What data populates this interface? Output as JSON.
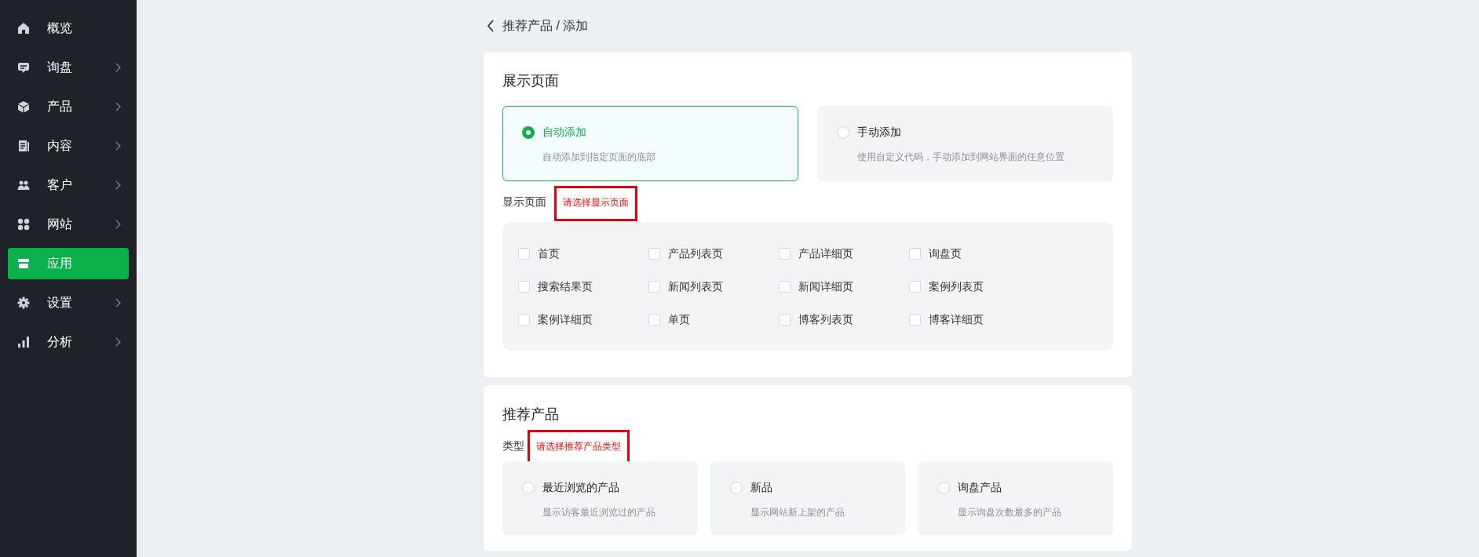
{
  "sidebar": {
    "items": [
      {
        "label": "概览",
        "expandable": false,
        "selected": false
      },
      {
        "label": "询盘",
        "expandable": true,
        "selected": false
      },
      {
        "label": "产品",
        "expandable": true,
        "selected": false
      },
      {
        "label": "内容",
        "expandable": true,
        "selected": false
      },
      {
        "label": "客户",
        "expandable": true,
        "selected": false
      },
      {
        "label": "网站",
        "expandable": true,
        "selected": false
      },
      {
        "label": "应用",
        "expandable": false,
        "selected": true
      },
      {
        "label": "设置",
        "expandable": true,
        "selected": false
      },
      {
        "label": "分析",
        "expandable": true,
        "selected": false
      }
    ]
  },
  "breadcrumb": "推荐产品 / 添加",
  "display_section": {
    "title": "展示页面",
    "modes": [
      {
        "label": "自动添加",
        "description": "自动添加到指定页面的底部",
        "selected": true
      },
      {
        "label": "手动添加",
        "description": "使用自定义代码，手动添加到网站界面的任意位置",
        "selected": false
      }
    ],
    "pages_label": "显示页面",
    "pages_error": "请选择显示页面",
    "pages": [
      {
        "label": "首页",
        "checked": false
      },
      {
        "label": "产品列表页",
        "checked": false
      },
      {
        "label": "产品详细页",
        "checked": false
      },
      {
        "label": "询盘页",
        "checked": false
      },
      {
        "label": "搜索结果页",
        "checked": false
      },
      {
        "label": "新闻列表页",
        "checked": false
      },
      {
        "label": "新闻详细页",
        "checked": false
      },
      {
        "label": "案例列表页",
        "checked": false
      },
      {
        "label": "案例详细页",
        "checked": false
      },
      {
        "label": "单页",
        "checked": false
      },
      {
        "label": "博客列表页",
        "checked": false
      },
      {
        "label": "博客详细页",
        "checked": false
      }
    ]
  },
  "product_section": {
    "title": "推荐产品",
    "type_label": "类型",
    "type_error": "请选择推荐产品类型",
    "types": [
      {
        "label": "最近浏览的产品",
        "description": "显示访客最近浏览过的产品",
        "selected": false
      },
      {
        "label": "新品",
        "description": "显示网站新上架的产品",
        "selected": false
      },
      {
        "label": "询盘产品",
        "description": "显示询盘次数最多的产品",
        "selected": false
      }
    ]
  }
}
